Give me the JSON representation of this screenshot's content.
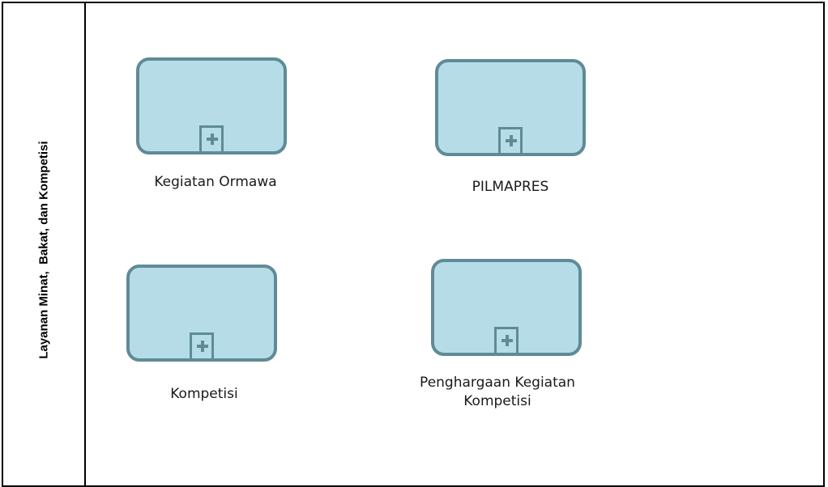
{
  "lane": {
    "title": "Layanan Minat,  Bakat, dan Kompetisi"
  },
  "tasks": [
    {
      "label": "Kegiatan Ormawa"
    },
    {
      "label": "PILMAPRES"
    },
    {
      "label": "Kompetisi"
    },
    {
      "label_line1": "Penghargaan Kegiatan",
      "label_line2": "Kompetisi"
    }
  ],
  "colors": {
    "task_fill": "#b6dde7",
    "task_border": "#5f8b96",
    "line": "#000000"
  }
}
